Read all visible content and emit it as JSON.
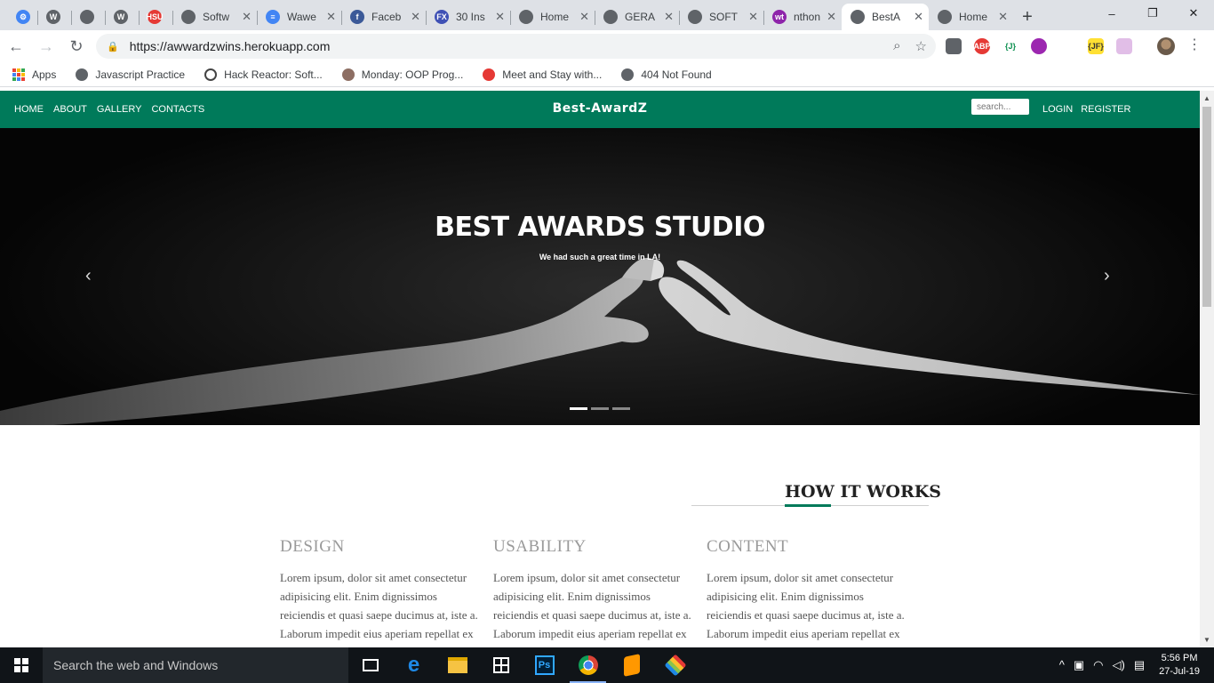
{
  "browser": {
    "tabs": [
      {
        "label": "",
        "icon": "chrome-gear-icon",
        "color": "#4285f4"
      },
      {
        "label": "",
        "icon": "wordpress-icon",
        "color": "#5f6368"
      },
      {
        "label": "",
        "icon": "globe-icon",
        "color": "#5f6368"
      },
      {
        "label": "",
        "icon": "wordpress-icon",
        "color": "#5f6368"
      },
      {
        "label": "",
        "icon": "hsu-icon",
        "color": "#e53935"
      },
      {
        "label": "Softw",
        "icon": "globe-icon",
        "color": "#5f6368"
      },
      {
        "label": "Wawe",
        "icon": "docs-icon",
        "color": "#4285f4"
      },
      {
        "label": "Faceb",
        "icon": "facebook-icon",
        "color": "#3b5998"
      },
      {
        "label": "30 Ins",
        "icon": "fx-icon",
        "color": "#3f51b5"
      },
      {
        "label": "Home",
        "icon": "globe-icon",
        "color": "#5f6368"
      },
      {
        "label": "GERA",
        "icon": "globe-icon",
        "color": "#5f6368"
      },
      {
        "label": "SOFT",
        "icon": "globe-icon",
        "color": "#5f6368"
      },
      {
        "label": "nthon",
        "icon": "wt-icon",
        "color": "#8e24aa"
      },
      {
        "label": "BestA",
        "icon": "globe-icon",
        "color": "#5f6368",
        "active": true
      },
      {
        "label": "Home",
        "icon": "globe-icon",
        "color": "#5f6368"
      }
    ],
    "new_tab": "+",
    "window_controls": [
      "–",
      "❐",
      "✕"
    ],
    "url": "https://awwardzwins.herokuapp.com",
    "bookmarks": [
      {
        "label": "Apps",
        "icon": "apps-grid-icon"
      },
      {
        "label": "Javascript Practice",
        "icon": "globe-icon"
      },
      {
        "label": "Hack Reactor: Soft...",
        "icon": "hack-reactor-icon"
      },
      {
        "label": "Monday: OOP Prog...",
        "icon": "tree-icon"
      },
      {
        "label": "Meet and Stay with...",
        "icon": "meetup-icon"
      },
      {
        "label": "404 Not Found",
        "icon": "globe-icon"
      }
    ],
    "extensions": [
      {
        "label": "",
        "icon": "shield-icon"
      },
      {
        "label": "ABP",
        "icon": "adblock-icon"
      },
      {
        "label": "{J}",
        "icon": "json-icon"
      },
      {
        "label": "",
        "icon": "purple-dots-icon"
      },
      {
        "label": "",
        "icon": "code-icon"
      },
      {
        "label": "{JF}",
        "icon": "json-formatter-icon"
      },
      {
        "label": "",
        "icon": "notes-icon"
      }
    ]
  },
  "site": {
    "nav_links": [
      "HOME",
      "ABOUT",
      "GALLERY",
      "CONTACTS"
    ],
    "brand": "Best-AwardZ",
    "search_placeholder": "search...",
    "auth_links": [
      "LOGIN",
      "REGISTER"
    ]
  },
  "hero": {
    "title": "BEST AWARDS STUDIO",
    "subtitle": "We had such a great time in LA!",
    "slide_count": 3,
    "active_slide": 1,
    "prev": "‹",
    "next": "›"
  },
  "how_it_works": {
    "heading": "HOW IT WORKS",
    "columns": [
      {
        "title": "DESIGN",
        "text": "Lorem ipsum, dolor sit amet consectetur adipisicing elit. Enim dignissimos reiciendis et quasi saepe ducimus at, iste a. Laborum impedit eius aperiam repellat ex"
      },
      {
        "title": "USABILITY",
        "text": "Lorem ipsum, dolor sit amet consectetur adipisicing elit. Enim dignissimos reiciendis et quasi saepe ducimus at, iste a. Laborum impedit eius aperiam repellat ex"
      },
      {
        "title": "CONTENT",
        "text": "Lorem ipsum, dolor sit amet consectetur adipisicing elit. Enim dignissimos reiciendis et quasi saepe ducimus at, iste a. Laborum impedit eius aperiam repellat ex"
      }
    ]
  },
  "taskbar": {
    "search_placeholder": "Search the web and Windows",
    "apps": [
      {
        "icon": "task-view-icon",
        "color": "#ffffff"
      },
      {
        "icon": "edge-icon",
        "color": "#1e88e5"
      },
      {
        "icon": "file-explorer-icon",
        "color": "#f6c343"
      },
      {
        "icon": "store-icon",
        "color": "#ffffff"
      },
      {
        "icon": "photoshop-icon",
        "color": "#31a8ff",
        "label": "Ps"
      },
      {
        "icon": "chrome-icon",
        "color": "#db4437",
        "running": true
      },
      {
        "icon": "sublime-icon",
        "color": "#ff9800"
      },
      {
        "icon": "bluestacks-icon",
        "color": "#8bc34a"
      }
    ],
    "tray_icons": [
      "^",
      "▣",
      "◠",
      "◁)",
      "▤"
    ],
    "time": "5:56 PM",
    "date": "27-Jul-19"
  },
  "colors": {
    "brand_green": "#007a5a",
    "tab_strip": "#dee1e6",
    "taskbar": "#101418"
  }
}
